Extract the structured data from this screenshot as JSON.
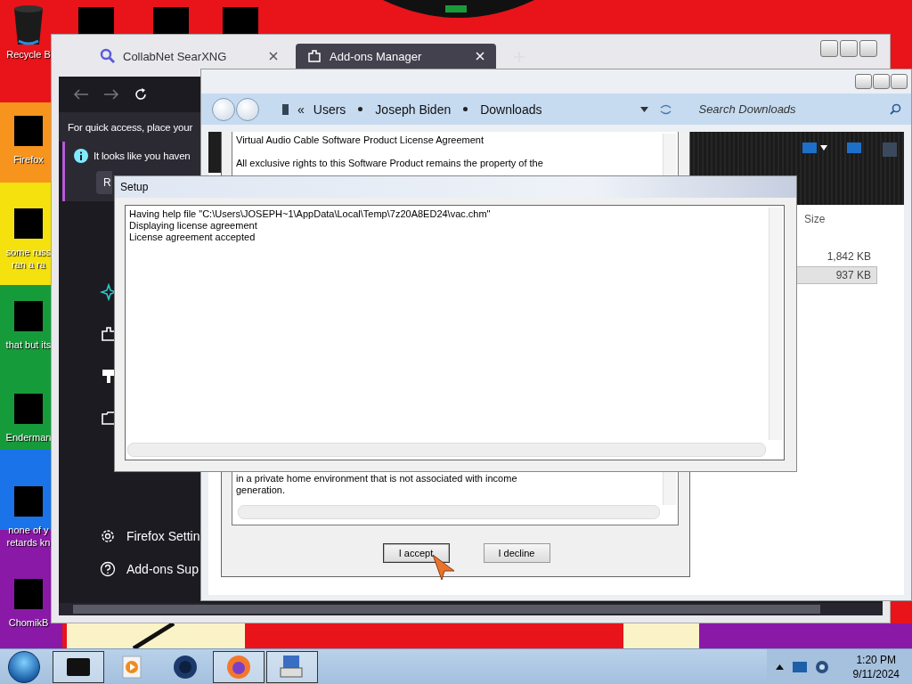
{
  "desktop_icons": [
    {
      "lines": [
        "Recycle B"
      ],
      "kind": "bin"
    },
    {
      "lines": [
        "Firefox"
      ],
      "kind": "app"
    },
    {
      "lines": [
        "some russ",
        "ran a ra"
      ],
      "kind": "app"
    },
    {
      "lines": [
        "that but its"
      ],
      "kind": "app"
    },
    {
      "lines": [
        "Enderman"
      ],
      "kind": "app"
    },
    {
      "lines": [
        "none of y",
        "retards kn"
      ],
      "kind": "app"
    },
    {
      "lines": [
        "ChomikB"
      ],
      "kind": "app"
    }
  ],
  "browser": {
    "tabs": [
      {
        "label": "CollabNet SearXNG",
        "selected": false
      },
      {
        "label": "Add-ons Manager",
        "selected": true
      }
    ],
    "quick_access": "For quick access, place your",
    "notice": {
      "text": "It looks like you haven",
      "button": "R"
    },
    "sidebar_links": [
      "Firefox Settin",
      "Add-ons Sup"
    ]
  },
  "explorer": {
    "breadcrumb_prefix": "«",
    "breadcrumb": [
      "Users",
      "Joseph Biden",
      "Downloads"
    ],
    "search": {
      "placeholder": "Search Downloads"
    },
    "size_column": "Size",
    "rows": [
      {
        "size": "1,842 KB",
        "selected": false
      },
      {
        "size": "937 KB",
        "selected": true
      }
    ]
  },
  "license_dialog": {
    "lines_top": [
      "Virtual Audio Cable Software Product License Agreement",
      "All exclusive rights to this Software Product remains the property of the"
    ],
    "lines_bottom": [
      "in a private home environment that is not associated with income",
      "generation."
    ],
    "buttons": [
      {
        "label": "I accept",
        "focused": true
      },
      {
        "label": "I decline",
        "focused": false
      }
    ]
  },
  "setup": {
    "title": "Setup",
    "log": [
      "Having help file \"C:\\Users\\JOSEPH~1\\AppData\\Local\\Temp\\7z20A8ED24\\vac.chm\"",
      "Displaying license agreement",
      "License agreement accepted"
    ]
  },
  "taskbar": {
    "time": "1:20 PM",
    "date": "9/11/2024"
  }
}
